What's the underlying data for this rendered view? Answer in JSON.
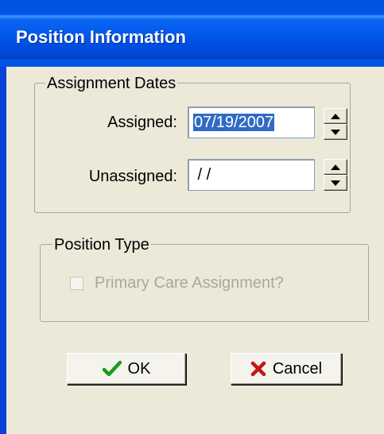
{
  "window": {
    "title": "Position Information"
  },
  "assignment_dates": {
    "legend": "Assignment Dates",
    "assigned_label": "Assigned:",
    "assigned_value": "07/19/2007",
    "unassigned_label": "Unassigned:",
    "unassigned_value": " / /"
  },
  "position_type": {
    "legend": "Position Type",
    "primary_care_label": "Primary Care Assignment?",
    "primary_care_checked": false,
    "enabled": false
  },
  "buttons": {
    "ok_label": "OK",
    "ok_icon": "checkmark-icon",
    "cancel_label": "Cancel",
    "cancel_icon": "x-icon"
  },
  "colors": {
    "titlebar": "#0054E3",
    "dialog_bg": "#ECE9D8",
    "selection": "#316AC5",
    "ok_check": "#1E9A1E",
    "cancel_x": "#C01818"
  }
}
